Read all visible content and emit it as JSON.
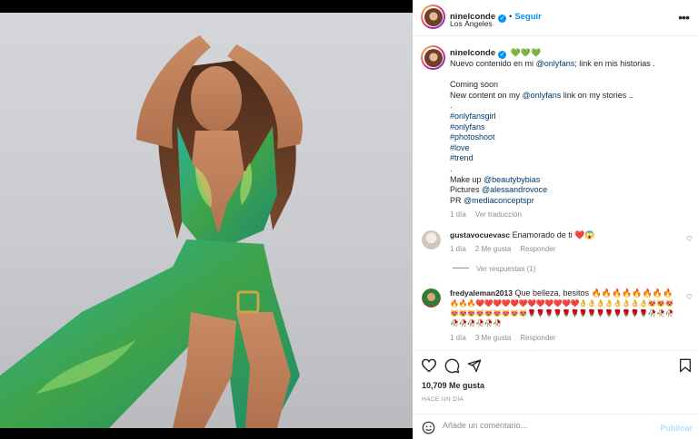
{
  "colors": {
    "accent": "#0095f6",
    "link": "#00376b",
    "muted": "#8e8e8e"
  },
  "header": {
    "username": "ninelconde",
    "follow_label": "Seguir",
    "location": "Los Ángeles",
    "more_icon": "more-horizontal-icon"
  },
  "caption": {
    "username": "ninelconde",
    "hearts": "💚💚💚",
    "line1_pre": "Nuevo contenido en mi ",
    "line1_link": "@onlyfans",
    "line1_post": "; link en mis historias .",
    "line2": "Coming soon",
    "line3_pre": "New content on my ",
    "line3_link": "@onlyfans",
    "line3_post": " link on my stories ..",
    "sep1": ".",
    "tags": [
      "#onlyfansgirl",
      "#onlyfans",
      "#photoshoot",
      "#love",
      "#trend"
    ],
    "sep2": ".",
    "makeup_pre": "Make up ",
    "makeup_link": "@beautybybias",
    "pictures_pre": "Pictures ",
    "pictures_link": "@alessandrovoce",
    "pr_pre": "PR ",
    "pr_link": "@mediaconceptspr",
    "time": "1 día",
    "translate": "Ver traducción"
  },
  "comments": [
    {
      "username": "gustavocuevasc",
      "text": "Enamorado de ti ❤️😱",
      "time": "1 día",
      "likes": "2 Me gusta",
      "reply": "Responder",
      "view_replies": "Ver respuestas (1)"
    },
    {
      "username": "fredyaleman2013",
      "text": "Que belleza, besitos 🔥🔥🔥🔥🔥🔥🔥🔥",
      "line2": "🔥🔥🔥❤️❤️❤️❤️❤️❤️❤️❤️❤️❤️❤️❤️👌👌👌👌👌👌👌👌😻😻😻",
      "line3": "😻😻😻😻😻😻😻😻😻🌹🌹🌹🌹🌹🌹🌹🌹🌹🌹🌹🌹🌹🌹🥀🥀🥀",
      "line4": "🥀🥀🥀🥀🥀🥀",
      "time": "1 día",
      "likes": "3 Me gusta",
      "reply": "Responder"
    }
  ],
  "actions": {
    "like_icon": "heart-icon",
    "comment_icon": "comment-icon",
    "share_icon": "share-icon",
    "save_icon": "bookmark-icon"
  },
  "likes_count": "10,709 Me gusta",
  "posted": "HACE UN DÍA",
  "add_comment": {
    "placeholder": "Añade un comentario...",
    "publish_label": "Publicar",
    "emoji_icon": "emoji-icon"
  }
}
